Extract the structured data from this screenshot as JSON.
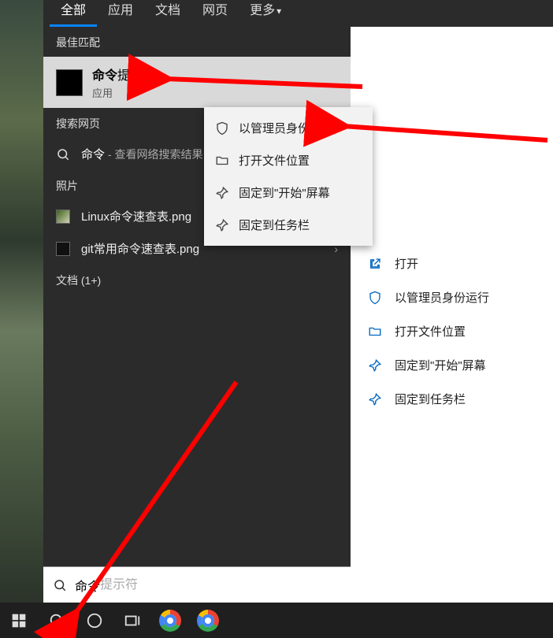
{
  "tabs": [
    "全部",
    "应用",
    "文档",
    "网页",
    "更多"
  ],
  "section": {
    "best": "最佳匹配",
    "web": "搜索网页",
    "photos": "照片",
    "docs": "文档 (1+)"
  },
  "best_match": {
    "title_bold": "命令",
    "title_rest": "提示符",
    "sub": "应用"
  },
  "web": {
    "bold": "命令",
    "hint": " - 查看网络搜索结果"
  },
  "photos": [
    "Linux命令速查表.png",
    "git常用命令速查表.png"
  ],
  "context_menu": [
    "以管理员身份运行",
    "打开文件位置",
    "固定到\"开始\"屏幕",
    "固定到任务栏"
  ],
  "right_actions": [
    "打开",
    "以管理员身份运行",
    "打开文件位置",
    "固定到\"开始\"屏幕",
    "固定到任务栏"
  ],
  "search_box": {
    "typed": "命令",
    "placeholder": "提示符"
  },
  "colors": {
    "accent": "#0a84ff",
    "link": "#0067c0"
  }
}
